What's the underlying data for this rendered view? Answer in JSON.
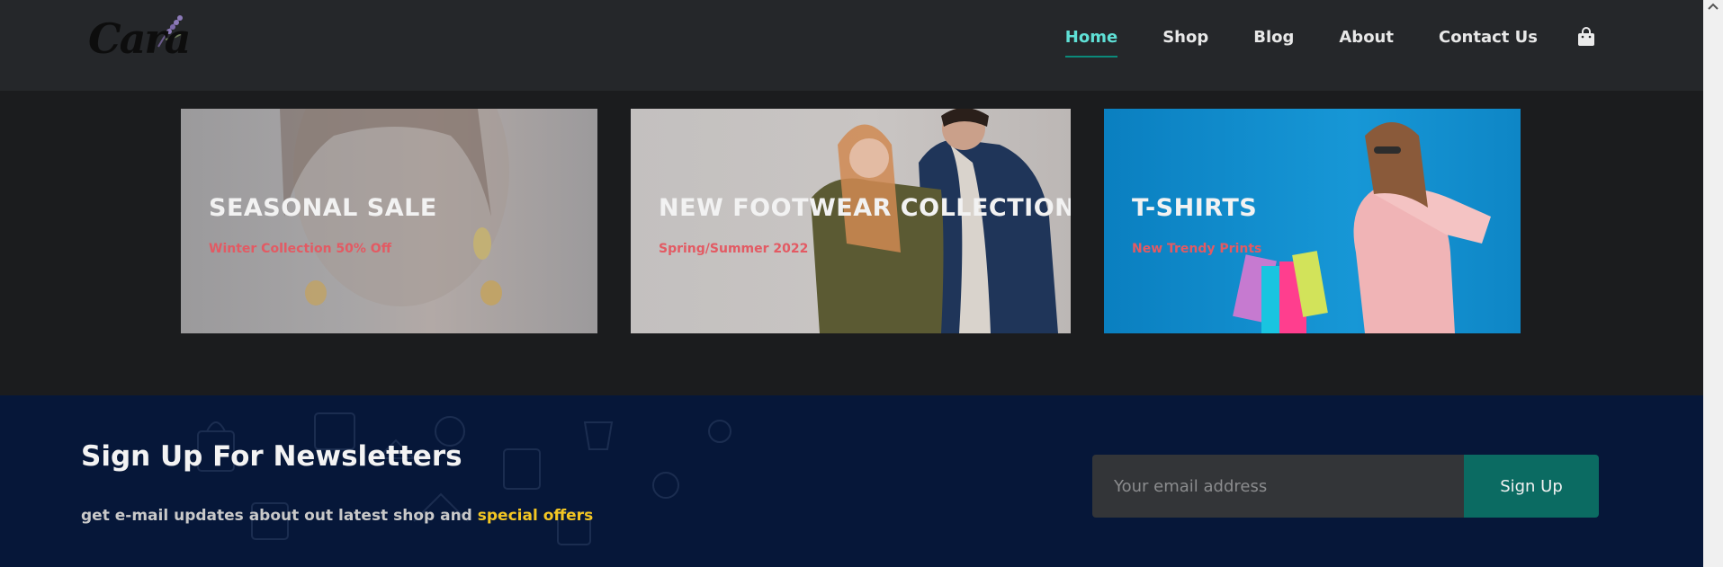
{
  "header": {
    "logo_text": "Cara",
    "nav": [
      {
        "label": "Home",
        "active": true
      },
      {
        "label": "Shop",
        "active": false
      },
      {
        "label": "Blog",
        "active": false
      },
      {
        "label": "About",
        "active": false
      },
      {
        "label": "Contact Us",
        "active": false
      }
    ],
    "cart_icon": "shopping-bag-icon"
  },
  "banners": [
    {
      "title": "SEASONAL SALE",
      "subtitle": "Winter Collection 50% Off"
    },
    {
      "title": "NEW FOOTWEAR COLLECTION",
      "subtitle": "Spring/Summer 2022"
    },
    {
      "title": "T-SHIRTS",
      "subtitle": "New Trendy Prints"
    }
  ],
  "newsletter": {
    "title": "Sign Up For Newsletters",
    "desc_prefix": "get e-mail updates about out latest shop and ",
    "desc_highlight": "special offers",
    "email_placeholder": "Your email address",
    "email_value": "",
    "button_label": "Sign Up"
  },
  "colors": {
    "accent": "#5fe0d6",
    "button": "#0b6b62",
    "highlight": "#f3c623",
    "banner_subtitle": "#e35a63",
    "newsletter_bg": "#061739"
  }
}
